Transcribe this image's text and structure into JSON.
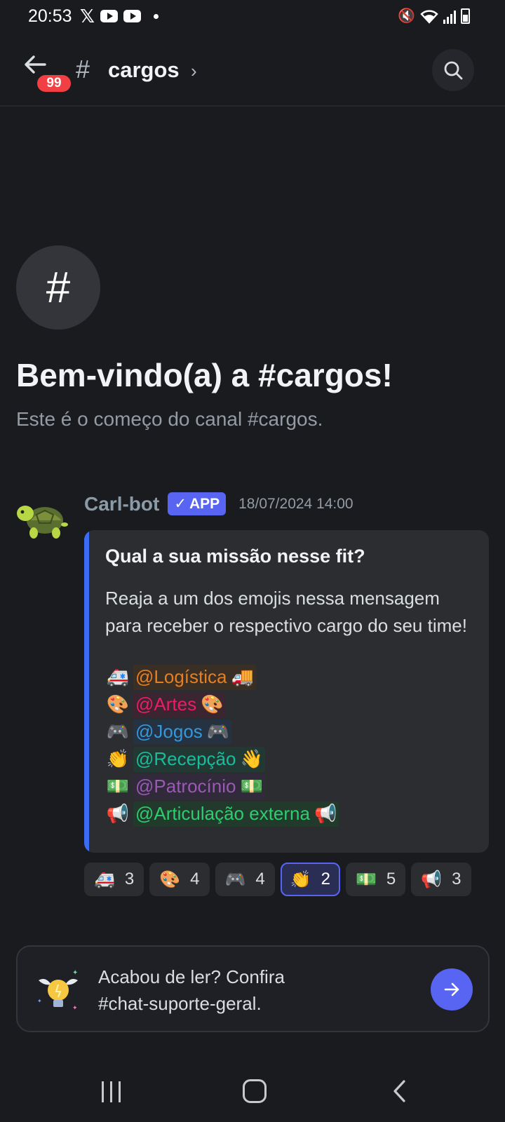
{
  "status_bar": {
    "time": "20:53",
    "left_icons": [
      "x-icon",
      "youtube-icon",
      "youtube-icon",
      "dot-icon"
    ],
    "right_icons": [
      "mute-icon",
      "wifi-icon",
      "signal-icon",
      "battery-icon"
    ],
    "x_glyph": "𝕏"
  },
  "header": {
    "unread_badge": "99",
    "hash": "#",
    "channel_name": "cargos",
    "chevron": "›"
  },
  "intro": {
    "icon_glyph": "#",
    "title": "Bem-vindo(a) a #cargos!",
    "subtitle": "Este é o começo do canal #cargos."
  },
  "message": {
    "author": "Carl-bot",
    "app_tag": "APP",
    "app_check": "✓",
    "timestamp": "18/07/2024 14:00",
    "embed": {
      "bar_color": "#3b6cf6",
      "title": "Qual a sua missão nesse fit?",
      "description": "Reaja a um dos emojis nessa mensagem para receber o respectivo cargo do seu time!",
      "roles": [
        {
          "emoji": "🚑",
          "mention": "@Logística",
          "trail": "🚚",
          "color": "#e67e22",
          "bg": "#3a2f24"
        },
        {
          "emoji": "🎨",
          "mention": "@Artes",
          "trail": "🎨",
          "color": "#e91e63",
          "bg": "#3b2530"
        },
        {
          "emoji": "🎮",
          "mention": "@Jogos",
          "trail": "🎮",
          "color": "#3498db",
          "bg": "#253242"
        },
        {
          "emoji": "👏",
          "mention": "@Recepção",
          "trail": "👋",
          "color": "#1abc9c",
          "bg": "#213833"
        },
        {
          "emoji": "💵",
          "mention": "@Patrocínio",
          "trail": "💵",
          "color": "#9b59b6",
          "bg": "#302a3b"
        },
        {
          "emoji": "📢",
          "mention": "@Articulação externa",
          "trail": "📢",
          "color": "#2ecc71",
          "bg": "#223a2b"
        }
      ]
    },
    "reactions": [
      {
        "emoji": "🚑",
        "count": "3",
        "active": false
      },
      {
        "emoji": "🎨",
        "count": "4",
        "active": false
      },
      {
        "emoji": "🎮",
        "count": "4",
        "active": false
      },
      {
        "emoji": "👏",
        "count": "2",
        "active": true
      },
      {
        "emoji": "💵",
        "count": "5",
        "active": false
      },
      {
        "emoji": "📢",
        "count": "3",
        "active": false
      }
    ]
  },
  "cta": {
    "line1": "Acabou de ler? Confira",
    "line2": "#chat-suporte-geral.",
    "icon": "winged-lightbulb-icon"
  },
  "colors": {
    "background": "#1a1b1f",
    "accent": "#5865f2",
    "badge": "#f23f43"
  }
}
